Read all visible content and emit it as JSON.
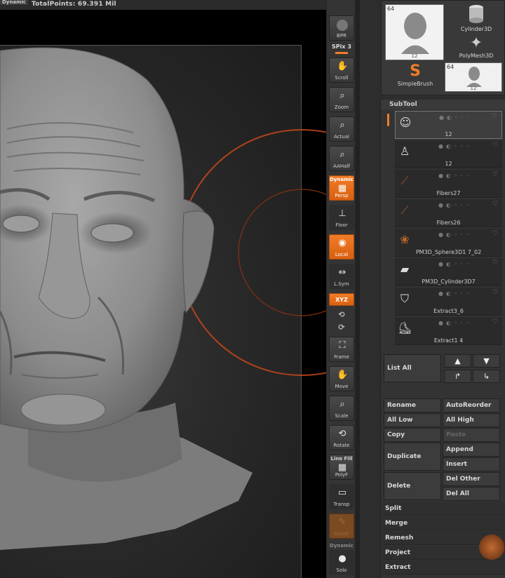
{
  "top": {
    "mode": "Dynamic",
    "points": "TotalPoints: 69.391 Mil"
  },
  "toolbar": {
    "bpr": "BPR",
    "spix": "SPix 3",
    "scroll": "Scroll",
    "zoom": "Zoom",
    "actual": "Actual",
    "aahalf": "AAHalf",
    "dynamic": "Dynamic",
    "persp": "Persp",
    "floor": "Floor",
    "local": "Local",
    "lsym": "L.Sym",
    "xyz": "XYZ",
    "frame": "Frame",
    "move": "Move",
    "scale": "Scale",
    "rotate": "Rotate",
    "linefill": "Line Fill",
    "polyf": "PolyF",
    "transp": "Transp",
    "ghost": "Ghost",
    "dynamic2": "Dynamic",
    "solo": "Solo"
  },
  "tool_palette": {
    "main_count": "64",
    "main_sub": "12",
    "cylinder": "Cylinder3D",
    "polymesh": "PolyMesh3D",
    "simplebrush": "SimpleBrush",
    "small_count": "64",
    "small_sub": "12"
  },
  "subtool": {
    "title": "SubTool",
    "items": [
      {
        "name": "12"
      },
      {
        "name": "12"
      },
      {
        "name": "Fibers27"
      },
      {
        "name": "Fibers26"
      },
      {
        "name": "PM3D_Sphere3D1 7_02"
      },
      {
        "name": "PM3D_Cylinder3D7"
      },
      {
        "name": "Extract3_6"
      },
      {
        "name": "Extract1 4"
      }
    ],
    "list_all": "List All",
    "rename": "Rename",
    "autoreorder": "AutoReorder",
    "all_low": "All Low",
    "all_high": "All High",
    "copy": "Copy",
    "paste": "Paste",
    "duplicate": "Duplicate",
    "append": "Append",
    "insert": "Insert",
    "delete": "Delete",
    "del_other": "Del Other",
    "del_all": "Del All",
    "split": "Split",
    "merge": "Merge",
    "remesh": "Remesh",
    "project": "Project",
    "extract": "Extract"
  },
  "colors": {
    "accent": "#f07c28",
    "ring": "#c8481a",
    "clay": "#8e8e8e"
  }
}
